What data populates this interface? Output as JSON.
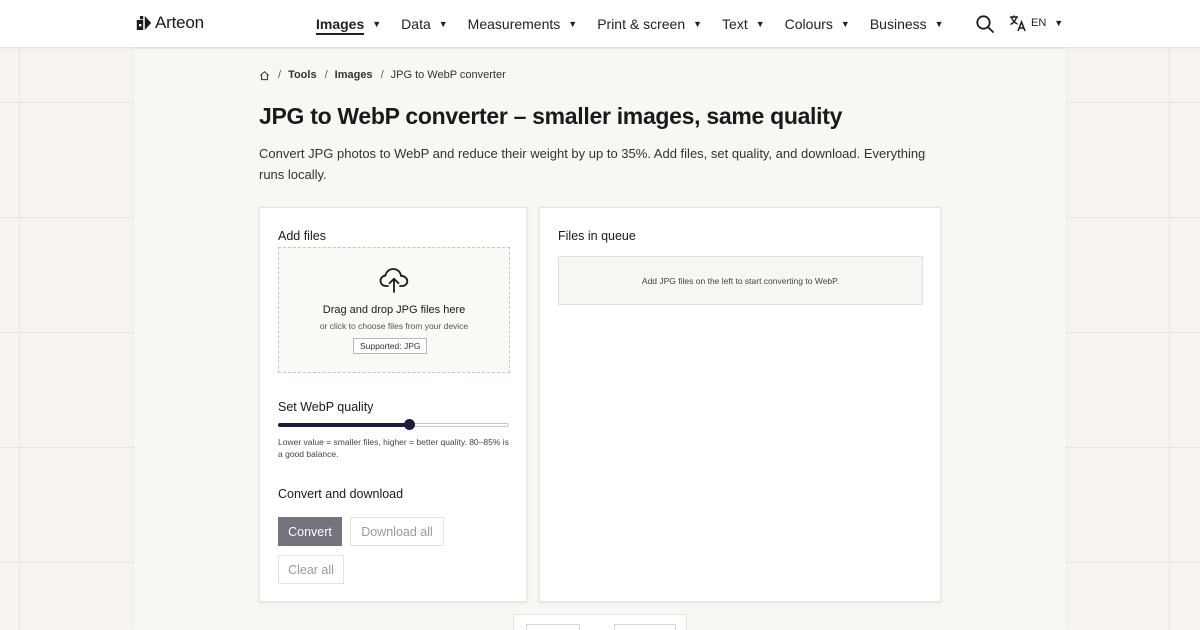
{
  "brand": {
    "name": "Arteon"
  },
  "nav": {
    "items": [
      {
        "label": "Images",
        "active": true
      },
      {
        "label": "Data"
      },
      {
        "label": "Measurements"
      },
      {
        "label": "Print & screen"
      },
      {
        "label": "Text"
      },
      {
        "label": "Colours"
      },
      {
        "label": "Business"
      }
    ],
    "caret": "▼"
  },
  "language": {
    "code": "EN"
  },
  "breadcrumb": {
    "items": [
      "Tools",
      "Images",
      "JPG to WebP converter"
    ],
    "separator": "/"
  },
  "page": {
    "title": "JPG to WebP converter – smaller images, same quality",
    "lead": "Convert JPG photos to WebP and reduce their weight by up to 35%. Add files, set quality, and download. Everything runs locally."
  },
  "add_files": {
    "title": "Add files",
    "drop_main": "Drag and drop JPG files here",
    "drop_sub": "or click to choose files from your device",
    "supported": "Supported: JPG"
  },
  "quality": {
    "title": "Set WebP quality",
    "value_fraction": 0.57,
    "hint": "Lower value = smaller files, higher = better quality. 80–85% is a good balance."
  },
  "actions": {
    "title": "Convert and download",
    "convert": "Convert",
    "download_all": "Download all",
    "clear_all": "Clear all"
  },
  "queue": {
    "title": "Files in queue",
    "empty": "Add JPG files on the left to start converting to WebP."
  },
  "colors": {
    "accent": "#1d1b3a",
    "convert_bg": "#75737c",
    "muted_text": "#9a9a9a"
  },
  "icons": {
    "logo": "arteon-logo-icon",
    "search": "search-icon",
    "language": "translate-icon",
    "home": "home-icon",
    "upload": "cloud-upload-icon"
  }
}
